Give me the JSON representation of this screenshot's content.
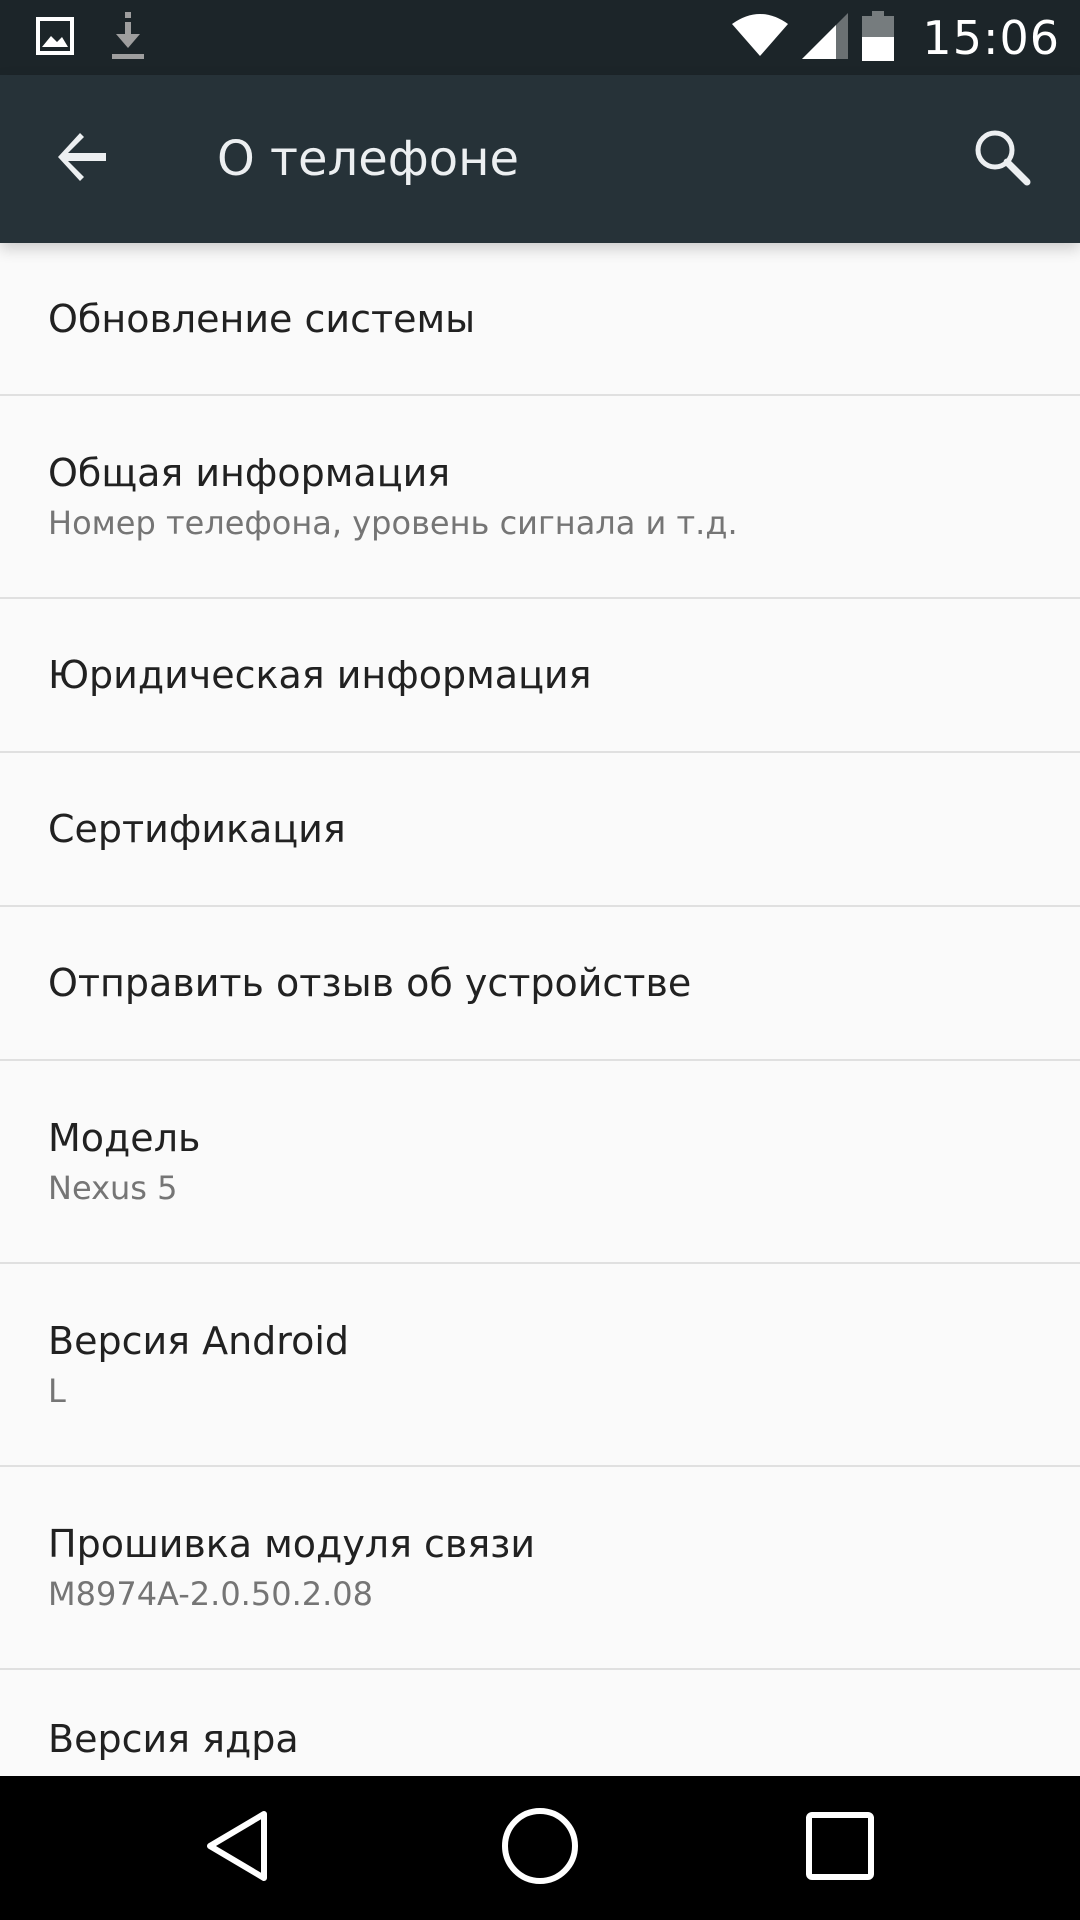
{
  "status_bar": {
    "time": "15:06",
    "icons": [
      "image-notification-icon",
      "download-notification-icon",
      "wifi-icon",
      "cell-signal-icon",
      "battery-icon"
    ]
  },
  "app_bar": {
    "title": "О телефоне",
    "back_icon": "arrow-back-icon",
    "search_icon": "search-icon"
  },
  "settings": {
    "items": [
      {
        "primary": "Обновление системы"
      },
      {
        "primary": "Общая информация",
        "secondary": "Номер телефона, уровень сигнала и т.д."
      },
      {
        "primary": "Юридическая информация"
      },
      {
        "primary": "Сертификация"
      },
      {
        "primary": "Отправить отзыв об устройстве"
      },
      {
        "primary": "Модель",
        "secondary": "Nexus 5"
      },
      {
        "primary": "Версия Android",
        "secondary": "L"
      },
      {
        "primary": "Прошивка модуля связи",
        "secondary": "M8974A-2.0.50.2.08"
      },
      {
        "primary": "Версия ядра"
      }
    ]
  },
  "nav_bar": {
    "icons": [
      "nav-back-icon",
      "nav-home-icon",
      "nav-recents-icon"
    ]
  },
  "colors": {
    "status_bar": "#1c2529",
    "app_bar": "#263238",
    "background": "#fafafa",
    "divider": "#e0e0e0",
    "primary_text": "#212121",
    "secondary_text": "#757575"
  }
}
